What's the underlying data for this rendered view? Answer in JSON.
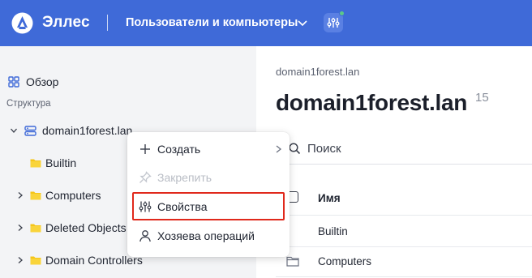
{
  "header": {
    "app_name": "Эллес",
    "module": "Пользователи и компьютеры",
    "brand_color": "#3f6ad8"
  },
  "sidebar": {
    "overview_label": "Обзор",
    "structure_label": "Структура",
    "tree": [
      {
        "label": "domain1forest.lan",
        "icon": "domain-icon",
        "expandable": true,
        "expanded": true
      },
      {
        "label": "Builtin",
        "icon": "folder-icon",
        "expandable": false
      },
      {
        "label": "Computers",
        "icon": "folder-icon",
        "expandable": true
      },
      {
        "label": "Deleted Objects",
        "icon": "folder-icon",
        "expandable": true
      },
      {
        "label": "Domain Controllers",
        "icon": "folder-icon",
        "expandable": true
      }
    ]
  },
  "main": {
    "breadcrumb": "domain1forest.lan",
    "title": "domain1forest.lan",
    "count": "15",
    "search_placeholder": "Поиск",
    "column_name": "Имя",
    "rows": [
      "Builtin",
      "Computers"
    ]
  },
  "context_menu": {
    "items": [
      {
        "label": "Создать",
        "icon": "plus-icon",
        "disabled": false,
        "submenu": true
      },
      {
        "label": "Закрепить",
        "icon": "pin-icon",
        "disabled": true,
        "submenu": false
      },
      {
        "label": "Свойства",
        "icon": "properties-icon",
        "disabled": false,
        "submenu": false,
        "highlighted": true
      },
      {
        "label": "Хозяева операций",
        "icon": "user-icon",
        "disabled": false,
        "submenu": false
      }
    ],
    "highlight_color": "#e0291c"
  }
}
